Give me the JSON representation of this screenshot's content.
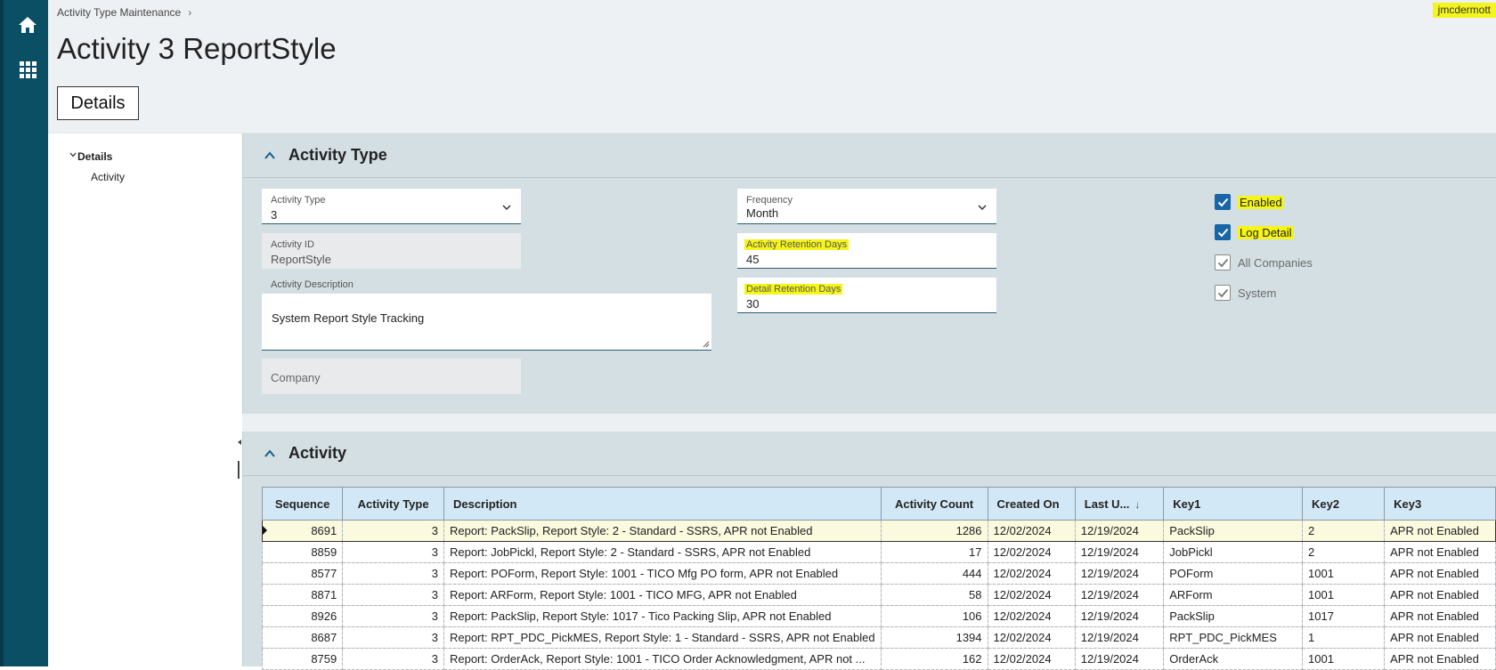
{
  "nav": {
    "home_icon": "home-icon",
    "apps_icon": "apps-grid-icon"
  },
  "breadcrumb": {
    "item": "Activity Type Maintenance",
    "separator": "›"
  },
  "user": {
    "name": "jmcdermott"
  },
  "page": {
    "title": "Activity 3 ReportStyle",
    "details_button": "Details"
  },
  "tree": {
    "root": "Details",
    "child": "Activity"
  },
  "activity_type_section": {
    "title": "Activity Type",
    "fields": {
      "activity_type": {
        "label": "Activity Type",
        "value": "3"
      },
      "activity_id": {
        "label": "Activity ID",
        "value": "ReportStyle"
      },
      "activity_description": {
        "label": "Activity Description",
        "value": "System Report Style Tracking"
      },
      "company": {
        "label": "Company",
        "value": ""
      },
      "frequency": {
        "label": "Frequency",
        "value": "Month"
      },
      "activity_retention_days": {
        "label": "Activity Retention Days",
        "value": "45"
      },
      "detail_retention_days": {
        "label": "Detail Retention Days",
        "value": "30"
      }
    },
    "checkboxes": {
      "enabled": "Enabled",
      "log_detail": "Log Detail",
      "all_companies": "All Companies",
      "system": "System"
    },
    "highlight_color": "#f5f51a"
  },
  "activity_section": {
    "title": "Activity",
    "columns": [
      "Sequence",
      "Activity Type",
      "Description",
      "Activity Count",
      "Created On",
      "Last U...",
      "Key1",
      "Key2",
      "Key3"
    ],
    "rows": [
      [
        "8691",
        "3",
        "Report: PackSlip, Report Style: 2 - Standard - SSRS, APR not Enabled",
        "1286",
        "12/02/2024",
        "12/19/2024",
        "PackSlip",
        "2",
        "APR not Enabled"
      ],
      [
        "8859",
        "3",
        "Report: JobPickl, Report Style: 2 - Standard - SSRS, APR not Enabled",
        "17",
        "12/02/2024",
        "12/19/2024",
        "JobPickl",
        "2",
        "APR not Enabled"
      ],
      [
        "8577",
        "3",
        "Report: POForm, Report Style: 1001 - TICO Mfg PO form, APR not Enabled",
        "444",
        "12/02/2024",
        "12/19/2024",
        "POForm",
        "1001",
        "APR not Enabled"
      ],
      [
        "8871",
        "3",
        "Report: ARForm, Report Style: 1001 - TICO MFG, APR not Enabled",
        "58",
        "12/02/2024",
        "12/19/2024",
        "ARForm",
        "1001",
        "APR not Enabled"
      ],
      [
        "8926",
        "3",
        "Report: PackSlip, Report Style: 1017 - Tico Packing Slip, APR not Enabled",
        "106",
        "12/02/2024",
        "12/19/2024",
        "PackSlip",
        "1017",
        "APR not Enabled"
      ],
      [
        "8687",
        "3",
        "Report: RPT_PDC_PickMES, Report Style: 1 - Standard - SSRS, APR not Enabled",
        "1394",
        "12/02/2024",
        "12/19/2024",
        "RPT_PDC_PickMES",
        "1",
        "APR not Enabled"
      ],
      [
        "8759",
        "3",
        "Report: OrderAck, Report Style: 1001 - TICO Order Acknowledgment, APR not ...",
        "162",
        "12/02/2024",
        "12/19/2024",
        "OrderAck",
        "1001",
        "APR not Enabled"
      ]
    ]
  },
  "colors": {
    "sidebar": "#0a4f63",
    "accent": "#1865a8",
    "header_bg": "#d2e8f6",
    "section_bg": "#d3dfe3"
  }
}
